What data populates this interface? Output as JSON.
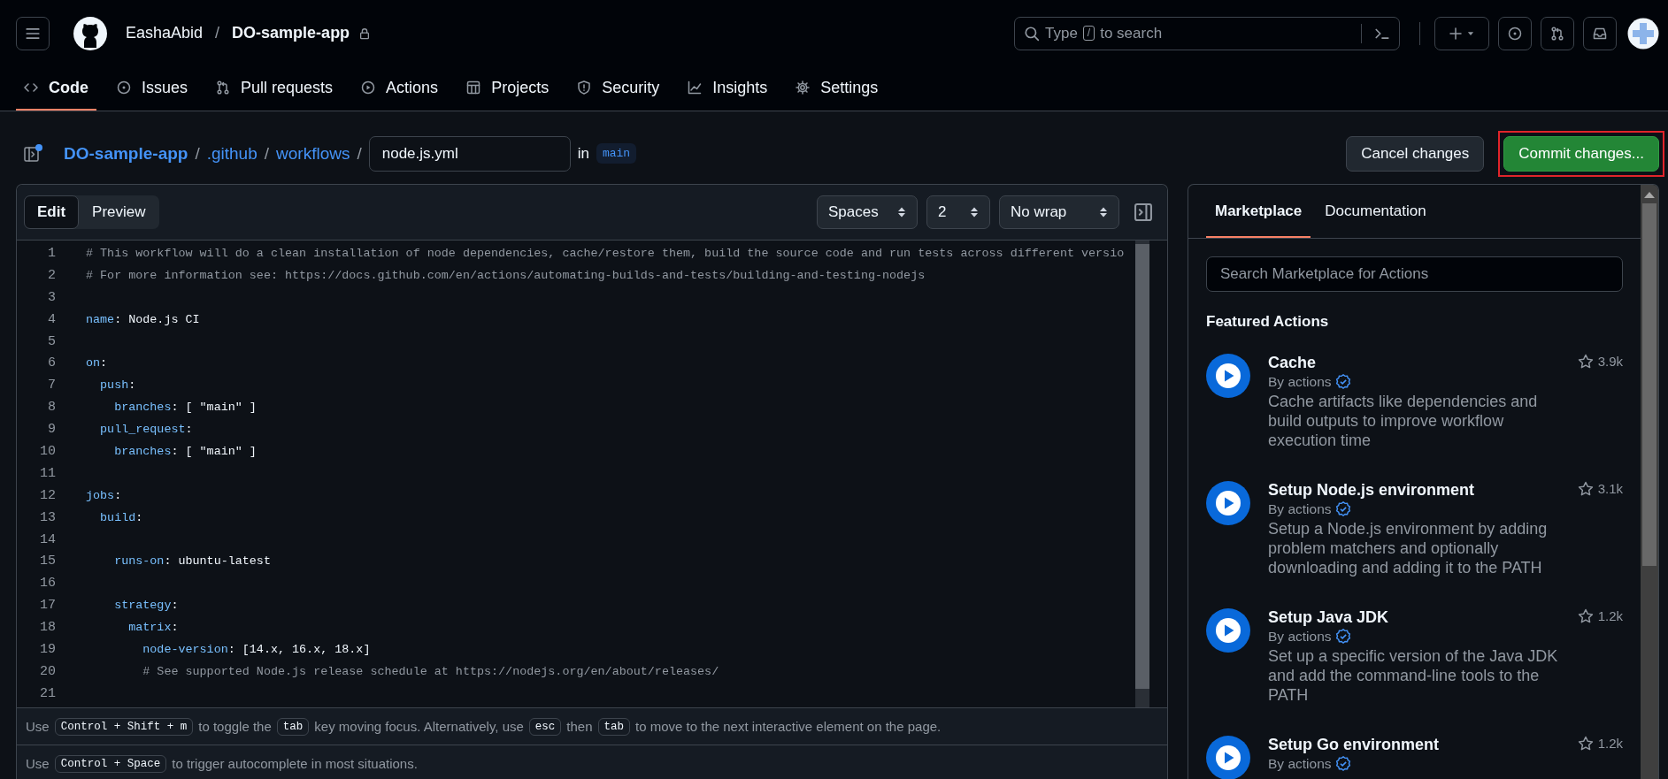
{
  "header": {
    "owner": "EashaAbid",
    "separator": "/",
    "repo": "DO-sample-app",
    "search": {
      "parts": [
        {
          "kind": "text",
          "text": "Type"
        },
        {
          "kind": "key",
          "text": "/"
        },
        {
          "kind": "text",
          "text": "to search"
        }
      ]
    }
  },
  "nav_tabs": [
    {
      "label": "Code",
      "selected": true
    },
    {
      "label": "Issues",
      "selected": false
    },
    {
      "label": "Pull requests",
      "selected": false
    },
    {
      "label": "Actions",
      "selected": false
    },
    {
      "label": "Projects",
      "selected": false
    },
    {
      "label": "Security",
      "selected": false
    },
    {
      "label": "Insights",
      "selected": false
    },
    {
      "label": "Settings",
      "selected": false
    }
  ],
  "breadcrumb": {
    "parts": [
      {
        "kind": "repo",
        "text": "DO-sample-app"
      },
      {
        "kind": "sep",
        "text": "/"
      },
      {
        "kind": "link",
        "text": ".github"
      },
      {
        "kind": "sep",
        "text": "/"
      },
      {
        "kind": "link",
        "text": "workflows"
      },
      {
        "kind": "sep",
        "text": "/"
      }
    ],
    "filename": "node.js.yml",
    "in_label": "in",
    "branch": "main"
  },
  "actions": {
    "cancel": "Cancel changes",
    "commit": "Commit changes..."
  },
  "editor": {
    "modes": [
      {
        "label": "Edit",
        "selected": true
      },
      {
        "label": "Preview",
        "selected": false
      }
    ],
    "selects": [
      "Spaces",
      "2",
      "No wrap"
    ],
    "lines": [
      {
        "number": "1",
        "tokens": [
          {
            "kind": "comment",
            "text": "# This workflow will do a clean installation of node dependencies, cache/restore them, build the source code and run tests across different versio"
          }
        ]
      },
      {
        "number": "2",
        "tokens": [
          {
            "kind": "comment",
            "text": "# For more information see: https://docs.github.com/en/actions/automating-builds-and-tests/building-and-testing-nodejs"
          }
        ]
      },
      {
        "number": "3"
      },
      {
        "number": "4",
        "tokens": [
          {
            "kind": "key",
            "text": "name"
          },
          {
            "kind": "plain",
            "text": ": Node.js CI"
          }
        ]
      },
      {
        "number": "5"
      },
      {
        "number": "6",
        "tokens": [
          {
            "kind": "key",
            "text": "on"
          },
          {
            "kind": "plain",
            "text": ":"
          }
        ]
      },
      {
        "number": "7",
        "tokens": [
          {
            "kind": "key",
            "text": "  push"
          },
          {
            "kind": "plain",
            "text": ":"
          }
        ]
      },
      {
        "number": "8",
        "tokens": [
          {
            "kind": "key",
            "text": "    branches"
          },
          {
            "kind": "plain",
            "text": ": [ \"main\" ]"
          }
        ]
      },
      {
        "number": "9",
        "tokens": [
          {
            "kind": "key",
            "text": "  pull_request"
          },
          {
            "kind": "plain",
            "text": ":"
          }
        ]
      },
      {
        "number": "10",
        "tokens": [
          {
            "kind": "key",
            "text": "    branches"
          },
          {
            "kind": "plain",
            "text": ": [ \"main\" ]"
          }
        ]
      },
      {
        "number": "11"
      },
      {
        "number": "12",
        "tokens": [
          {
            "kind": "key",
            "text": "jobs"
          },
          {
            "kind": "plain",
            "text": ":"
          }
        ]
      },
      {
        "number": "13",
        "tokens": [
          {
            "kind": "key",
            "text": "  build"
          },
          {
            "kind": "plain",
            "text": ":"
          }
        ]
      },
      {
        "number": "14"
      },
      {
        "number": "15",
        "tokens": [
          {
            "kind": "key",
            "text": "    runs-on"
          },
          {
            "kind": "plain",
            "text": ": ubuntu-latest"
          }
        ]
      },
      {
        "number": "16"
      },
      {
        "number": "17",
        "tokens": [
          {
            "kind": "key",
            "text": "    strategy"
          },
          {
            "kind": "plain",
            "text": ":"
          }
        ]
      },
      {
        "number": "18",
        "tokens": [
          {
            "kind": "key",
            "text": "      matrix"
          },
          {
            "kind": "plain",
            "text": ":"
          }
        ]
      },
      {
        "number": "19",
        "tokens": [
          {
            "kind": "key",
            "text": "        node-version"
          },
          {
            "kind": "plain",
            "text": ": [14.x, 16.x, 18.x]"
          }
        ]
      },
      {
        "number": "20",
        "tokens": [
          {
            "kind": "comment",
            "text": "        # See supported Node.js release schedule at https://nodejs.org/en/about/releases/"
          }
        ]
      },
      {
        "number": "21"
      }
    ],
    "hints": [
      {
        "parts": [
          {
            "kind": "text",
            "text": "Use"
          },
          {
            "kind": "key",
            "text": "Control + Shift + m"
          },
          {
            "kind": "text",
            "text": "to toggle the"
          },
          {
            "kind": "key",
            "text": "tab"
          },
          {
            "kind": "text",
            "text": "key moving focus. Alternatively, use"
          },
          {
            "kind": "key",
            "text": "esc"
          },
          {
            "kind": "text",
            "text": "then"
          },
          {
            "kind": "key",
            "text": "tab"
          },
          {
            "kind": "text",
            "text": "to move to the next interactive element on the page."
          }
        ]
      },
      {
        "parts": [
          {
            "kind": "text",
            "text": "Use"
          },
          {
            "kind": "key",
            "text": "Control + Space"
          },
          {
            "kind": "text",
            "text": "to trigger autocomplete in most situations."
          }
        ]
      }
    ]
  },
  "sidebar": {
    "tabs": [
      {
        "label": "Marketplace",
        "selected": true
      },
      {
        "label": "Documentation",
        "selected": false
      }
    ],
    "search": {
      "placeholder": "Search Marketplace for Actions"
    },
    "heading": "Featured Actions",
    "items": [
      {
        "title": "Cache",
        "author": "By actions",
        "verified": true,
        "description": "Cache artifacts like dependencies and build outputs to improve workflow execution time",
        "stars": "3.9k"
      },
      {
        "title": "Setup Node.js environment",
        "author": "By actions",
        "verified": true,
        "description": "Setup a Node.js environment by adding problem matchers and optionally downloading and adding it to the PATH",
        "stars": "3.1k"
      },
      {
        "title": "Setup Java JDK",
        "author": "By actions",
        "verified": true,
        "description": "Set up a specific version of the Java JDK and add the command-line tools to the PATH",
        "stars": "1.2k"
      },
      {
        "title": "Setup Go environment",
        "author": "By actions",
        "verified": true,
        "stars": "1.2k"
      }
    ]
  }
}
